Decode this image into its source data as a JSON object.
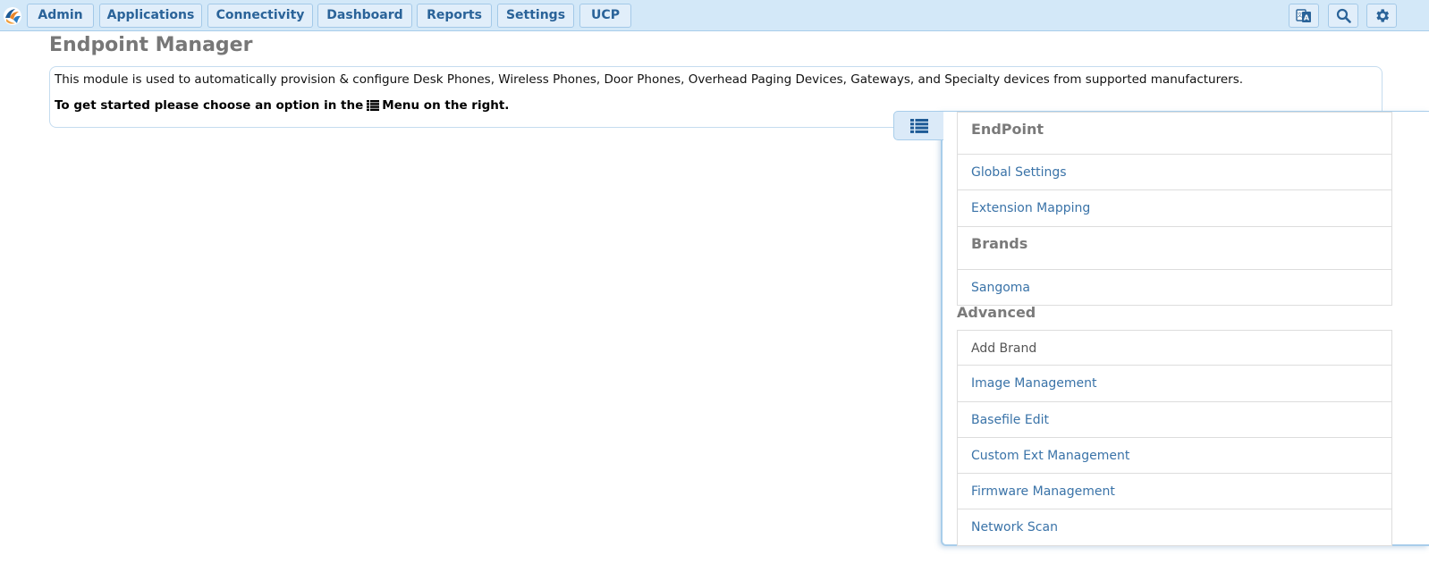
{
  "topbar": {
    "nav": [
      "Admin",
      "Applications",
      "Connectivity",
      "Dashboard",
      "Reports",
      "Settings",
      "UCP"
    ],
    "icons": [
      "language-icon",
      "search-icon",
      "gear-icon"
    ],
    "accent": "#2a6399",
    "bar_color": "#d3e8f8"
  },
  "page": {
    "title": "Endpoint Manager",
    "intro_text": "This module is used to automatically provision & configure Desk Phones, Wireless Phones, Door Phones, Overhead Paging Devices, Gateways, and Specialty devices from supported manufacturers.",
    "instruction_before": "To get started please choose an option in the",
    "instruction_after": "Menu on the right."
  },
  "menu": {
    "endpoint_heading": "EndPoint",
    "endpoint_items": [
      "Global Settings",
      "Extension Mapping"
    ],
    "brands_heading": "Brands",
    "brand_items": [
      "Sangoma"
    ],
    "advanced_heading": "Advanced",
    "advanced_items": [
      "Add Brand",
      "Image Management",
      "Basefile Edit",
      "Custom Ext Management",
      "Firmware Management",
      "Network Scan"
    ],
    "link_color": "#3a73a8"
  }
}
